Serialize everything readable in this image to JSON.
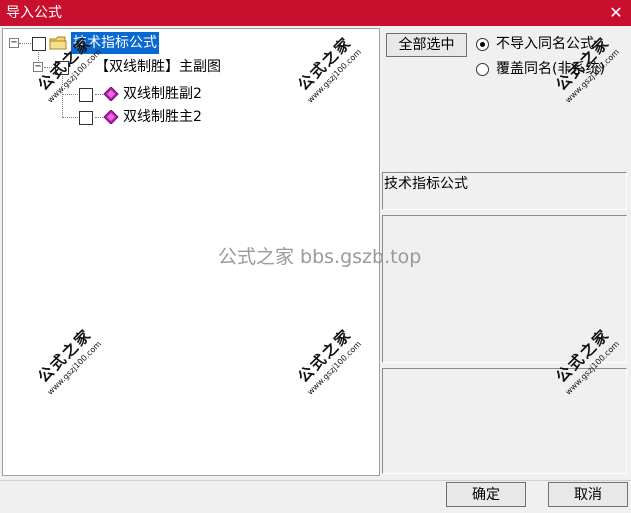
{
  "window": {
    "title": "导入公式",
    "close_glyph": "✕"
  },
  "tree": {
    "root": {
      "label": "技术指标公式",
      "expander": "−"
    },
    "group": {
      "label": "【双线制胜】主副图",
      "expander": "−"
    },
    "items": [
      {
        "label": "双线制胜副2"
      },
      {
        "label": "双线制胜主2"
      }
    ]
  },
  "options": {
    "select_all_label": "全部选中",
    "radio_skip_label": "不导入同名公式",
    "radio_overwrite_label": "覆盖同名(非系统)",
    "selected_radio": "skip"
  },
  "details": {
    "formula_type": "技术指标公式"
  },
  "footer": {
    "ok_label": "确定",
    "cancel_label": "取消"
  },
  "watermark": {
    "center_text": "公式之家 bbs.gszb.top",
    "stamp_title": "公式之家",
    "stamp_url": "www.gszj100.com"
  }
}
